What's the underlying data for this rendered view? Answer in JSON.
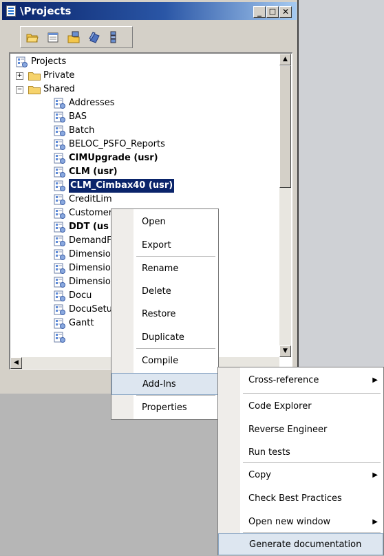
{
  "window": {
    "title": "\\Projects"
  },
  "caption_buttons": {
    "minimize": "_",
    "maximize": "□",
    "close": "✕"
  },
  "toolbar": {
    "icons": [
      "open-project-icon",
      "new-project-icon",
      "import-icon",
      "layers-icon",
      "compare-icon"
    ]
  },
  "tree": {
    "root": "Projects",
    "private": "Private",
    "shared": "Shared",
    "items": [
      {
        "label": "Addresses",
        "bold": false
      },
      {
        "label": "BAS",
        "bold": false
      },
      {
        "label": "Batch",
        "bold": false
      },
      {
        "label": "BELOC_PSFO_Reports",
        "bold": false
      },
      {
        "label": "CIMUpgrade (usr)",
        "bold": true
      },
      {
        "label": "CLM (usr)",
        "bold": true
      },
      {
        "label": "CLM_Cimbax40 (usr)",
        "bold": true,
        "selected": true
      },
      {
        "label": "CreditLim",
        "bold": false
      },
      {
        "label": "Customer",
        "bold": false
      },
      {
        "label": "DDT (us",
        "bold": true
      },
      {
        "label": "DemandF",
        "bold": false
      },
      {
        "label": "Dimensior",
        "bold": false
      },
      {
        "label": "Dimensior",
        "bold": false
      },
      {
        "label": "Dimensior",
        "bold": false
      },
      {
        "label": "Docu",
        "bold": false
      },
      {
        "label": "DocuSetu",
        "bold": false
      },
      {
        "label": "Gantt",
        "bold": false
      }
    ]
  },
  "context_menu": {
    "items": [
      "Open",
      "Export",
      "Rename",
      "Delete",
      "Restore",
      "Duplicate",
      "Compile",
      "Add-Ins",
      "Properties"
    ],
    "highlighted": "Add-Ins"
  },
  "submenu": {
    "items": [
      {
        "label": "Cross-reference",
        "has_arrow": true
      },
      {
        "label": "Code Explorer",
        "has_arrow": false
      },
      {
        "label": "Reverse Engineer",
        "has_arrow": false
      },
      {
        "label": "Run tests",
        "has_arrow": false
      },
      {
        "label": "Copy",
        "has_arrow": true
      },
      {
        "label": "Check Best Practices",
        "has_arrow": false
      },
      {
        "label": "Open new window",
        "has_arrow": true
      },
      {
        "label": "Generate documentation",
        "has_arrow": false
      }
    ],
    "highlighted": "Generate documentation",
    "arrow_glyph": "▶"
  }
}
